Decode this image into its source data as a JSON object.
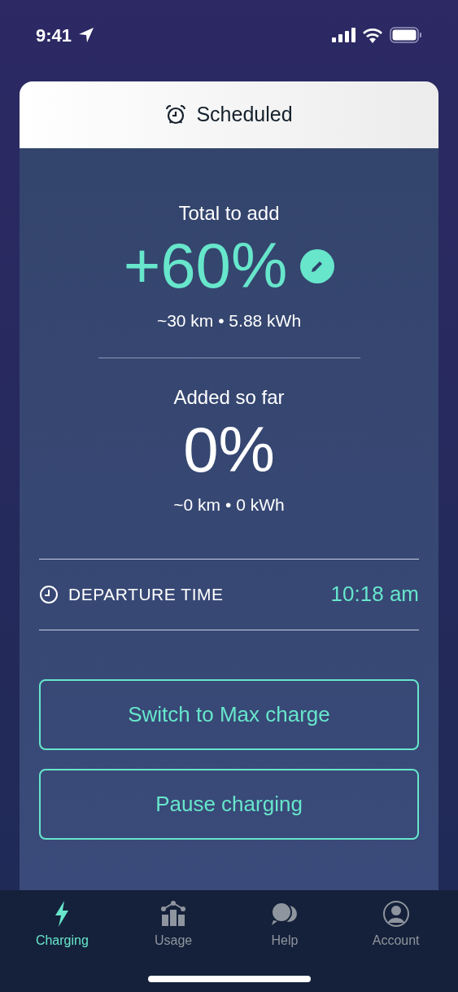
{
  "status_bar": {
    "time": "9:41"
  },
  "card": {
    "header": "Scheduled",
    "total": {
      "label": "Total to add",
      "value": "+60%",
      "detail": "~30 km • 5.88 kWh"
    },
    "added": {
      "label": "Added so far",
      "value": "0%",
      "detail": "~0 km • 0 kWh"
    },
    "departure": {
      "label": "DEPARTURE TIME",
      "value": "10:18 am"
    },
    "buttons": [
      "Switch to Max charge",
      "Pause charging"
    ]
  },
  "tabs": [
    {
      "kind": "charging",
      "label": "Charging",
      "selected": true
    },
    {
      "kind": "usage",
      "label": "Usage",
      "selected": false
    },
    {
      "kind": "help",
      "label": "Help",
      "selected": false
    },
    {
      "kind": "account",
      "label": "Account",
      "selected": false
    }
  ]
}
